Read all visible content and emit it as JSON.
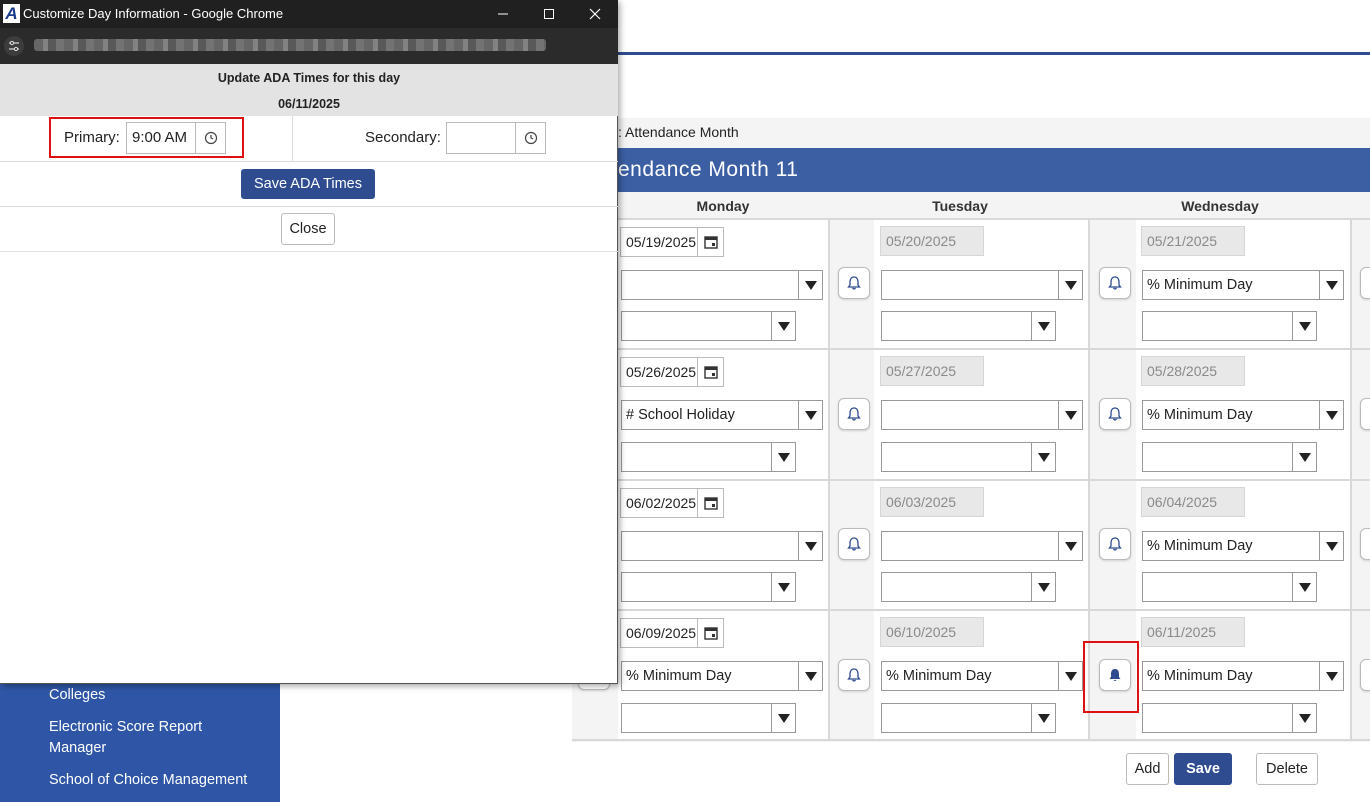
{
  "popup": {
    "window_title": "Customize Day Information - Google Chrome",
    "heading": "Update ADA Times for this day",
    "date": "06/11/2025",
    "primary_label": "Primary:",
    "primary_value": "9:00 AM",
    "secondary_label": "Secondary:",
    "secondary_value": "",
    "save_label": "Save ADA Times",
    "close_label": "Close"
  },
  "app": {
    "breadcrumb": ": Attendance Month",
    "month_title": "endance Month 11",
    "days": [
      "Monday",
      "Tuesday",
      "Wednesday"
    ],
    "weeks": [
      {
        "mon_date": "05/19/2025",
        "tue_date": "05/20/2025",
        "wed_date": "05/21/2025",
        "mon_sel1": "",
        "tue_sel1": "",
        "wed_sel1": "% Minimum Day",
        "mon_sel2": "",
        "tue_sel2": "",
        "wed_sel2": ""
      },
      {
        "mon_date": "05/26/2025",
        "tue_date": "05/27/2025",
        "wed_date": "05/28/2025",
        "mon_sel1": "# School Holiday",
        "tue_sel1": "",
        "wed_sel1": "% Minimum Day",
        "mon_sel2": "",
        "tue_sel2": "",
        "wed_sel2": ""
      },
      {
        "mon_date": "06/02/2025",
        "tue_date": "06/03/2025",
        "wed_date": "06/04/2025",
        "mon_sel1": "",
        "tue_sel1": "",
        "wed_sel1": "% Minimum Day",
        "mon_sel2": "",
        "tue_sel2": "",
        "wed_sel2": ""
      },
      {
        "mon_date": "06/09/2025",
        "tue_date": "06/10/2025",
        "wed_date": "06/11/2025",
        "mon_sel1": "% Minimum Day",
        "tue_sel1": "% Minimum Day",
        "wed_sel1": "% Minimum Day",
        "mon_sel2": "",
        "tue_sel2": "",
        "wed_sel2": ""
      }
    ],
    "buttons": {
      "add": "Add",
      "save": "Save",
      "delete": "Delete"
    },
    "sidebar": [
      "Colleges",
      "Electronic Score Report Manager",
      "School of Choice Management"
    ],
    "colors": {
      "brand_blue": "#2e4c8f",
      "month_bar": "#3c5fa4",
      "sidebar": "#2f56a6",
      "highlight_red": "#dd1111"
    }
  }
}
